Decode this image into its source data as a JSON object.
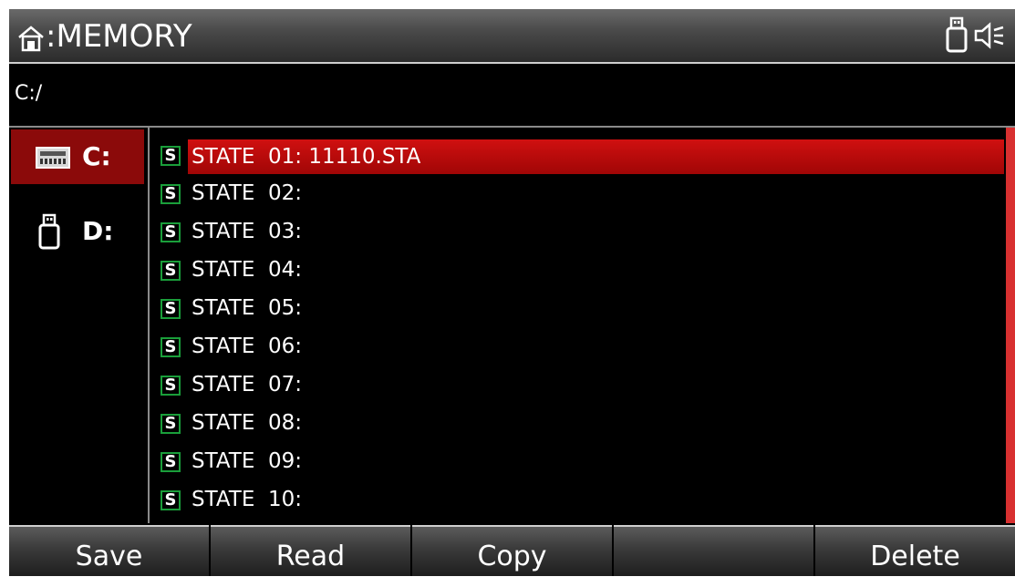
{
  "title": {
    "text": ":MEMORY",
    "icons": [
      "home-icon",
      "usb-icon",
      "speaker-muted-icon"
    ]
  },
  "path": "C:/",
  "drives": [
    {
      "label": "C:",
      "icon": "internal-memory-icon",
      "selected": true
    },
    {
      "label": "D:",
      "icon": "usb-drive-icon",
      "selected": false
    }
  ],
  "files": [
    {
      "name": "STATE  01: 11110.STA",
      "icon": "state-file-icon",
      "selected": true
    },
    {
      "name": "STATE  02:",
      "icon": "state-file-icon",
      "selected": false
    },
    {
      "name": "STATE  03:",
      "icon": "state-file-icon",
      "selected": false
    },
    {
      "name": "STATE  04:",
      "icon": "state-file-icon",
      "selected": false
    },
    {
      "name": "STATE  05:",
      "icon": "state-file-icon",
      "selected": false
    },
    {
      "name": "STATE  06:",
      "icon": "state-file-icon",
      "selected": false
    },
    {
      "name": "STATE  07:",
      "icon": "state-file-icon",
      "selected": false
    },
    {
      "name": "STATE  08:",
      "icon": "state-file-icon",
      "selected": false
    },
    {
      "name": "STATE  09:",
      "icon": "state-file-icon",
      "selected": false
    },
    {
      "name": "STATE  10:",
      "icon": "state-file-icon",
      "selected": false
    }
  ],
  "file_icon_glyph": "S",
  "softkeys": [
    "Save",
    "Read",
    "Copy",
    "",
    "Delete"
  ],
  "colors": {
    "selection": "#c00808",
    "drive_selection": "#8b0a0a",
    "file_icon_border": "#1a9e3a",
    "scrollbar": "#d83030"
  }
}
